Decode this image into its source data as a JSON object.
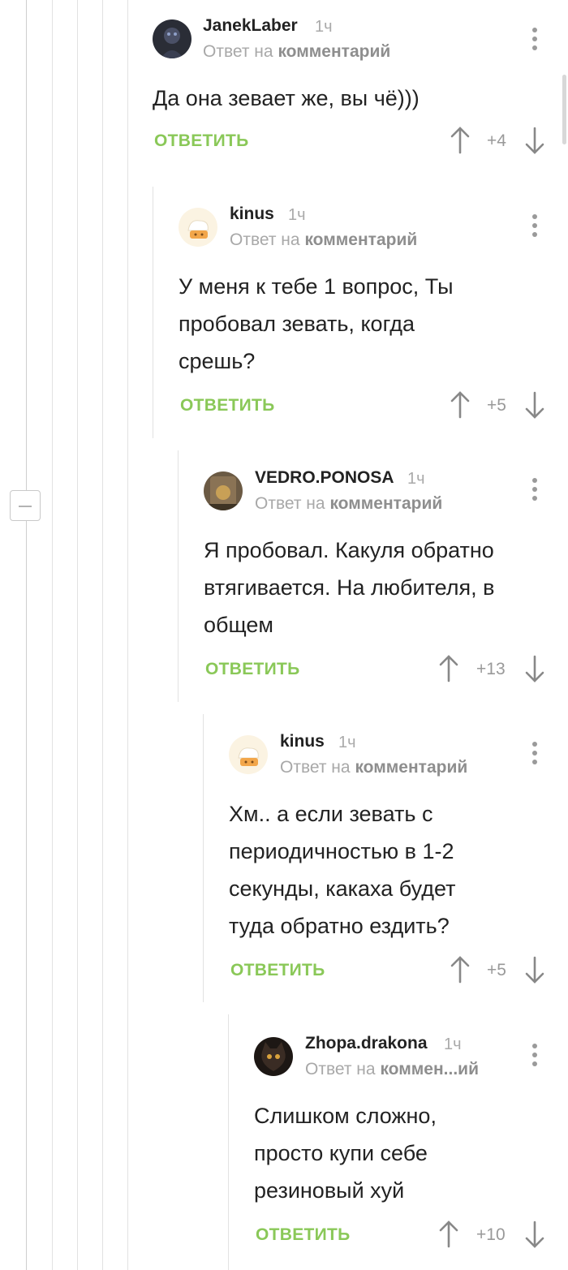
{
  "reply_label": "ОТВЕТИТЬ",
  "reply_prefix": "Ответ на",
  "reply_target": "комментарий",
  "colors": {
    "accent_green": "#8ac858",
    "meta_gray": "#a8a8a8",
    "line_gray": "#e2e2e2"
  },
  "comments": [
    {
      "author": "JanekLaber",
      "time": "1ч",
      "reply_target": "комментарий",
      "text_lines": [
        "Да она зевает же, вы чё)))"
      ],
      "rating": "+4"
    },
    {
      "author": "kinus",
      "time": "1ч",
      "reply_target": "комментарий",
      "text_lines": [
        "У меня к тебе 1 вопрос, Ты",
        "пробовал зевать, когда",
        "срешь?"
      ],
      "rating": "+5"
    },
    {
      "author": "VEDRO.PONOSA",
      "time": "1ч",
      "reply_target": "комментарий",
      "text_lines": [
        "Я пробовал. Какуля обратно",
        "втягивается. На любителя, в",
        "общем"
      ],
      "rating": "+13"
    },
    {
      "author": "kinus",
      "time": "1ч",
      "reply_target": "комментарий",
      "text_lines": [
        "Хм.. а если зевать с",
        "периодичностью в 1-2",
        "секунды, какаха будет",
        "туда обратно ездить?"
      ],
      "rating": "+5"
    },
    {
      "author": "Zhopa.drakona",
      "time": "1ч",
      "reply_target": "коммен...ий",
      "text_lines": [
        "Слишком сложно,",
        "просто купи себе",
        "резиновый хуй"
      ],
      "rating": "+10"
    }
  ]
}
